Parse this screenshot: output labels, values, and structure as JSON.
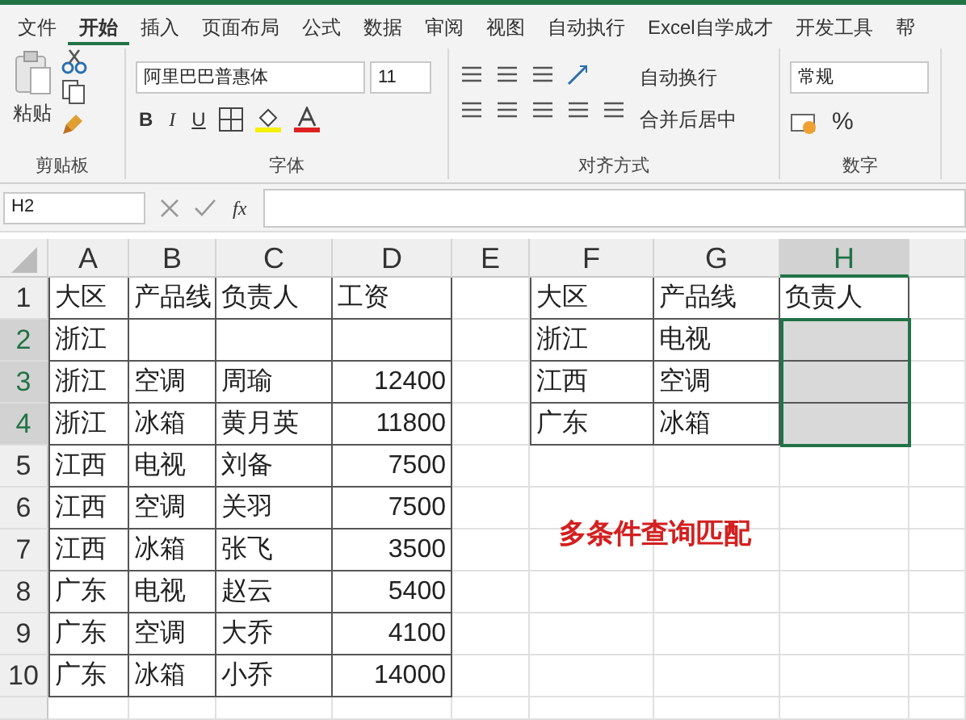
{
  "tabs": [
    {
      "label": "文件",
      "selected": false
    },
    {
      "label": "开始",
      "selected": true
    },
    {
      "label": "插入",
      "selected": false
    },
    {
      "label": "页面布局",
      "selected": false
    },
    {
      "label": "公式",
      "selected": false
    },
    {
      "label": "数据",
      "selected": false
    },
    {
      "label": "审阅",
      "selected": false
    },
    {
      "label": "视图",
      "selected": false
    },
    {
      "label": "自动执行",
      "selected": false
    },
    {
      "label": "Excel自学成才",
      "selected": false
    },
    {
      "label": "开发工具",
      "selected": false
    },
    {
      "label": "帮",
      "selected": false
    }
  ],
  "ribbon": {
    "clipboard": {
      "paste": "粘贴",
      "group": "剪贴板"
    },
    "font": {
      "font_name": "阿里巴巴普惠体",
      "font_size": "11",
      "bold": "B",
      "italic": "I",
      "underline": "U",
      "group": "字体"
    },
    "alignment": {
      "wrap": "自动换行",
      "merge": "合并后居中",
      "group": "对齐方式"
    },
    "number": {
      "format": "常规",
      "percent": "%",
      "group": "数字"
    }
  },
  "formula_bar": {
    "name_box": "H2",
    "fx": "fx"
  },
  "sheet": {
    "columns": [
      {
        "label": "A",
        "selected": false
      },
      {
        "label": "B",
        "selected": false
      },
      {
        "label": "C",
        "selected": false
      },
      {
        "label": "D",
        "selected": false
      },
      {
        "label": "E",
        "selected": false
      },
      {
        "label": "F",
        "selected": false
      },
      {
        "label": "G",
        "selected": false
      },
      {
        "label": "H",
        "selected": true
      }
    ],
    "rows": [
      {
        "label": "1",
        "selected": false,
        "cells": [
          {
            "text": "大区",
            "selected": false
          },
          {
            "text": "产品线",
            "selected": false
          },
          {
            "text": "负责人",
            "selected": false
          },
          {
            "text": "工资",
            "selected": false
          },
          {
            "selected": false
          },
          {
            "text": "大区",
            "selected": false
          },
          {
            "text": "产品线",
            "selected": false
          },
          {
            "text": "负责人",
            "selected": false
          }
        ]
      },
      {
        "label": "2",
        "selected": true,
        "cells": [
          {
            "text": "浙江",
            "selected": false
          },
          {
            "selected": false
          },
          {
            "selected": false
          },
          {
            "selected": false
          },
          {
            "selected": false
          },
          {
            "text": "浙江",
            "selected": false
          },
          {
            "text": "电视",
            "selected": false
          },
          {
            "selected": true
          }
        ]
      },
      {
        "label": "3",
        "selected": true,
        "cells": [
          {
            "text": "浙江",
            "selected": false
          },
          {
            "text": "空调",
            "selected": false
          },
          {
            "text": "周瑜",
            "selected": false
          },
          {
            "text": "12400",
            "selected": false
          },
          {
            "selected": false
          },
          {
            "text": "江西",
            "selected": false
          },
          {
            "text": "空调",
            "selected": false
          },
          {
            "selected": true
          }
        ]
      },
      {
        "label": "4",
        "selected": true,
        "cells": [
          {
            "text": "浙江",
            "selected": false
          },
          {
            "text": "冰箱",
            "selected": false
          },
          {
            "text": "黄月英",
            "selected": false
          },
          {
            "text": "11800",
            "selected": false
          },
          {
            "selected": false
          },
          {
            "text": "广东",
            "selected": false
          },
          {
            "text": "冰箱",
            "selected": false
          },
          {
            "selected": true
          }
        ]
      },
      {
        "label": "5",
        "selected": false,
        "cells": [
          {
            "text": "江西",
            "selected": false
          },
          {
            "text": "电视",
            "selected": false
          },
          {
            "text": "刘备",
            "selected": false
          },
          {
            "text": "7500",
            "selected": false
          }
        ]
      },
      {
        "label": "6",
        "selected": false,
        "cells": [
          {
            "text": "江西",
            "selected": false
          },
          {
            "text": "空调",
            "selected": false
          },
          {
            "text": "关羽",
            "selected": false
          },
          {
            "text": "7500",
            "selected": false
          }
        ]
      },
      {
        "label": "7",
        "selected": false,
        "cells": [
          {
            "text": "江西",
            "selected": false
          },
          {
            "text": "冰箱",
            "selected": false
          },
          {
            "text": "张飞",
            "selected": false
          },
          {
            "text": "3500",
            "selected": false
          }
        ]
      },
      {
        "label": "8",
        "selected": false,
        "cells": [
          {
            "text": "广东",
            "selected": false
          },
          {
            "text": "电视",
            "selected": false
          },
          {
            "text": "赵云",
            "selected": false
          },
          {
            "text": "5400",
            "selected": false
          }
        ]
      },
      {
        "label": "9",
        "selected": false,
        "cells": [
          {
            "text": "广东",
            "selected": false
          },
          {
            "text": "空调",
            "selected": false
          },
          {
            "text": "大乔",
            "selected": false
          },
          {
            "text": "4100",
            "selected": false
          }
        ]
      },
      {
        "label": "10",
        "selected": false,
        "cells": [
          {
            "text": "广东",
            "selected": false
          },
          {
            "text": "冰箱",
            "selected": false
          },
          {
            "text": "小乔",
            "selected": false
          },
          {
            "text": "14000",
            "selected": false
          }
        ]
      }
    ]
  },
  "annotation": "多条件查询匹配"
}
